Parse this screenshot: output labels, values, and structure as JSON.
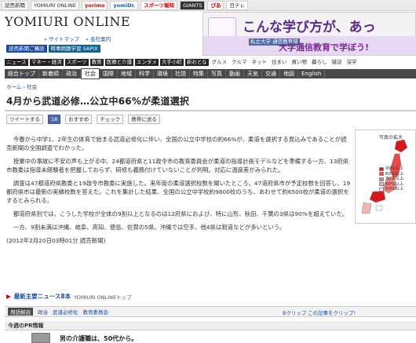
{
  "top_nav": [
    "読売新聞",
    "YOMIURI ONLINE",
    "yorimo",
    "yomiDr.",
    "スポーツ報知",
    "GIANTS",
    "ぴあ",
    "日テレ"
  ],
  "site": {
    "logo": "YOMIURI ONLINE",
    "sitemap": "» サイトマップ",
    "company": "» 会社案内"
  },
  "small_links": [
    "読売新聞ご購読",
    "時事問題学習 SAPIX"
  ],
  "ad": {
    "headline": "こんな学び方が、あっ",
    "school": "私立大学 通信教育部",
    "slogan": "大学通信教育で学ぼう!"
  },
  "category_row": [
    "ニュース",
    "マネー・経済",
    "スポーツ",
    "教育",
    "医療と介護",
    "エンタメ",
    "大手小町",
    "新おとな",
    "グルメ",
    "クルマ",
    "ネット",
    "住まい",
    "買い物",
    "暮らし",
    "雑誌",
    "深学"
  ],
  "sub_nav": [
    "総合トップ",
    "新着順",
    "政治",
    "社会",
    "国際",
    "地域",
    "科学",
    "環境",
    "社説",
    "特集",
    "写真",
    "動画",
    "天気",
    "交通",
    "地図",
    "English"
  ],
  "breadcrumb": {
    "home": "ホーム",
    "sep": "›",
    "current": "社会"
  },
  "article": {
    "title": "4月から武道必修…公立中66%が柔道選択",
    "paragraphs": [
      "今春から中学1、2年生の体育で始まる武道必修化に伴い、全国の公立中学校の約66%が、柔道を選択する見込みであることが読売新聞の全国調査でわかった。",
      "授業中の事故に不安の声も上がる中、24都道府県と11政令市の教育委員会が柔道の指導計画モデルなどを準備する一方、13府県市教委は指導未経験者を把握しておらず、研修も義務付けていないことが判明。対応に温度差がみられた。",
      "調査は47都道府県教委と19政令市教委に実施した。来年度の柔道選択校数を聞いたところ、47道府県市が予定校数を回答し、19都府県市は最新の実績校数を答えた。これを集計した結果、全国の公立中学校約9800校のうち、あわせて約6500校が柔道の選択をするとみられる。",
      "都道府県別では、こうした学校が全体の9割以上となるのは12府県におよび、特に山形、秋田、千葉の3県は90%を超えていた。",
      "一方、9割未満は沖縄、岐阜、高知、徳島、佐賀の5県。沖縄では空手、他4県は剣道などが多いという。"
    ],
    "timestamp": "(2012年2月20日03時01分  読売新聞)"
  },
  "social": [
    "ツイートする",
    "18",
    "おすすめ",
    "チェック",
    "携帯に送る"
  ],
  "map": {
    "caption": "写真の拡大",
    "legend": [
      "90%以上",
      "80%以上",
      "70%以上",
      "60%以上",
      "50%以上"
    ]
  },
  "latest_news": {
    "title": "最新主要ニュース8本",
    "source": "YOMIURI ONLINEトップ"
  },
  "tags": {
    "label": "用語解説",
    "items": [
      "政治",
      "武道必修化",
      "教育委員会"
    ],
    "bclip": "Bクリップ",
    "clip": "この記事をクリップ!"
  },
  "pr": {
    "header": "今週のPR情報",
    "headline": "男の介護職は、50代から。"
  }
}
